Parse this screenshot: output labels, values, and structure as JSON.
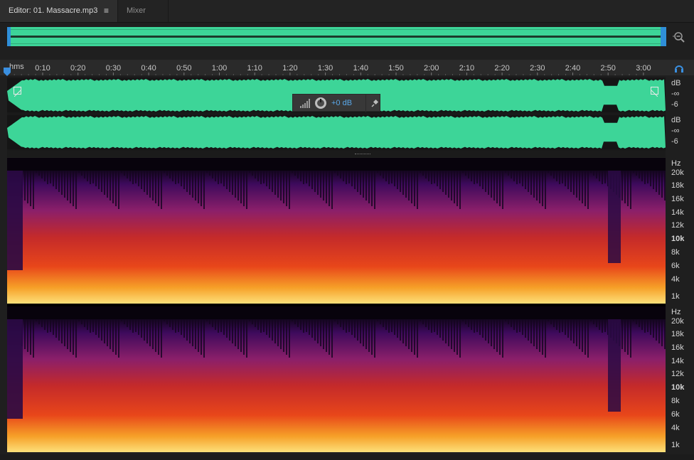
{
  "tabs": {
    "editor_label": "Editor: 01. Massacre.mp3",
    "menu_glyph": "≡",
    "mixer_label": "Mixer"
  },
  "ruler": {
    "unit_label": "hms",
    "ticks": [
      "0:10",
      "0:20",
      "0:30",
      "0:40",
      "0:50",
      "1:00",
      "1:10",
      "1:20",
      "1:30",
      "1:40",
      "1:50",
      "2:00",
      "2:10",
      "2:20",
      "2:30",
      "2:40",
      "2:50",
      "3:00"
    ]
  },
  "amplitude_scale": {
    "ch1": [
      "dB",
      "-∞",
      "-6"
    ],
    "ch2": [
      "dB",
      "-∞",
      "-6"
    ]
  },
  "hud": {
    "gain_value": "+0 dB"
  },
  "frequency_scale": {
    "unit": "Hz",
    "labels": [
      "20k",
      "18k",
      "16k",
      "14k",
      "12k",
      "10k",
      "8k",
      "6k",
      "4k",
      "1k"
    ]
  },
  "icons": {
    "zoom": "zoom-out-magnifier-icon",
    "monitor": "headphones-icon",
    "pin": "pin-icon",
    "knob": "volume-knob-icon",
    "signal": "signal-level-icon"
  },
  "colors": {
    "waveform": "#3dd598",
    "accent": "#2f8fd8",
    "background": "#1f1f1f"
  }
}
